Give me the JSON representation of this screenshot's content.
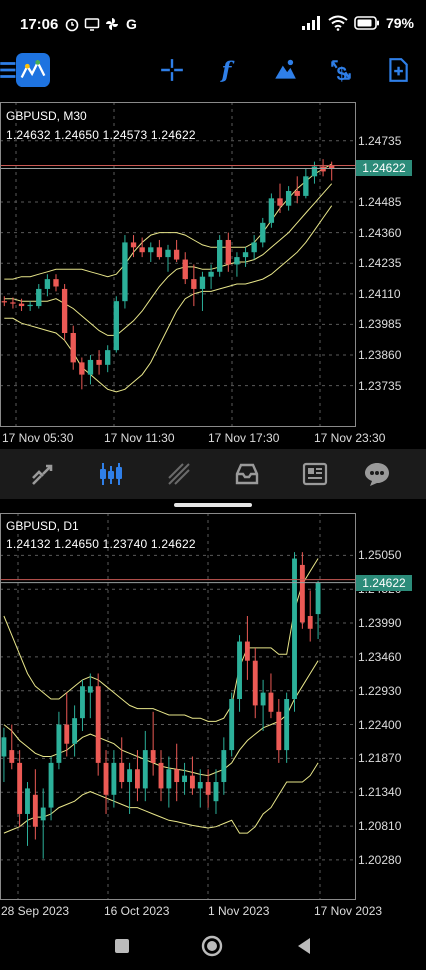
{
  "status_bar": {
    "time": "17:06",
    "battery": "79"
  },
  "colors": {
    "accent": "#2f7fe8",
    "bull": "#2cb09a",
    "bear": "#ec5a55",
    "bands": "#e8e68a",
    "grid": "#5a5a5a",
    "price_tag": "#2c8c7a"
  },
  "toolbar": {
    "icons": [
      "menu-icon",
      "metatrader-logo",
      "crosshair-icon",
      "indicators-icon",
      "objects-icon",
      "symbol-change-icon",
      "new-order-icon"
    ]
  },
  "chart_data": [
    {
      "type": "candlestick",
      "symbol_label": "GBPUSD, M30",
      "ohlc_label": "1.24632 1.24650 1.24573 1.24622",
      "last_price": "1.24622",
      "y_ticks": [
        "1.24735",
        "1.24485",
        "1.24360",
        "1.24235",
        "1.24110",
        "1.23985",
        "1.23860",
        "1.23735"
      ],
      "x_ticks": [
        "17 Nov 05:30",
        "17 Nov 11:30",
        "17 Nov 17:30",
        "17 Nov 23:30"
      ],
      "ylim": [
        1.2366,
        1.2482
      ],
      "candles": [
        [
          1.2408,
          1.241,
          1.2406,
          1.24075
        ],
        [
          1.24075,
          1.24095,
          1.2405,
          1.2407
        ],
        [
          1.2407,
          1.2409,
          1.2404,
          1.2406
        ],
        [
          1.2406,
          1.2408,
          1.2404,
          1.24065
        ],
        [
          1.2406,
          1.2415,
          1.2405,
          1.2413
        ],
        [
          1.2413,
          1.2419,
          1.241,
          1.2417
        ],
        [
          1.2417,
          1.2419,
          1.2412,
          1.2414
        ],
        [
          1.2413,
          1.2415,
          1.2392,
          1.2395
        ],
        [
          1.2395,
          1.2398,
          1.238,
          1.2383
        ],
        [
          1.2383,
          1.2385,
          1.2372,
          1.2378
        ],
        [
          1.2378,
          1.2386,
          1.2374,
          1.2384
        ],
        [
          1.2384,
          1.2388,
          1.2378,
          1.2382
        ],
        [
          1.2382,
          1.239,
          1.2379,
          1.2388
        ],
        [
          1.2388,
          1.241,
          1.2387,
          1.2408
        ],
        [
          1.2408,
          1.2435,
          1.2405,
          1.2432
        ],
        [
          1.2432,
          1.2435,
          1.2426,
          1.243
        ],
        [
          1.243,
          1.2434,
          1.2426,
          1.2428
        ],
        [
          1.2428,
          1.2432,
          1.2424,
          1.243
        ],
        [
          1.243,
          1.2433,
          1.2425,
          1.2426
        ],
        [
          1.2426,
          1.2431,
          1.242,
          1.2429
        ],
        [
          1.2429,
          1.2433,
          1.2424,
          1.2425
        ],
        [
          1.2425,
          1.2428,
          1.2415,
          1.2417
        ],
        [
          1.2417,
          1.2423,
          1.2406,
          1.2413
        ],
        [
          1.2413,
          1.242,
          1.2404,
          1.2418
        ],
        [
          1.2418,
          1.2423,
          1.2413,
          1.242
        ],
        [
          1.242,
          1.2435,
          1.2418,
          1.2433
        ],
        [
          1.2433,
          1.2436,
          1.242,
          1.2423
        ],
        [
          1.2423,
          1.2428,
          1.2418,
          1.2426
        ],
        [
          1.2426,
          1.243,
          1.2422,
          1.2428
        ],
        [
          1.2428,
          1.2435,
          1.2425,
          1.2432
        ],
        [
          1.2432,
          1.2442,
          1.243,
          1.244
        ],
        [
          1.244,
          1.2452,
          1.2438,
          1.245
        ],
        [
          1.245,
          1.2456,
          1.2444,
          1.2447
        ],
        [
          1.2447,
          1.2455,
          1.2445,
          1.2453
        ],
        [
          1.2453,
          1.2459,
          1.2448,
          1.2451
        ],
        [
          1.2451,
          1.2462,
          1.245,
          1.2459
        ],
        [
          1.2459,
          1.2465,
          1.2456,
          1.2463
        ],
        [
          1.2463,
          1.2466,
          1.2459,
          1.2461
        ],
        [
          1.24632,
          1.2465,
          1.24573,
          1.24622
        ]
      ],
      "bands": {
        "upper": [
          1.2417,
          1.2417,
          1.2418,
          1.2418,
          1.2419,
          1.242,
          1.2421,
          1.2421,
          1.2421,
          1.2421,
          1.242,
          1.2419,
          1.2418,
          1.2419,
          1.2423,
          1.2428,
          1.2432,
          1.2435,
          1.2436,
          1.2436,
          1.2436,
          1.2435,
          1.2433,
          1.2431,
          1.243,
          1.243,
          1.243,
          1.243,
          1.243,
          1.2432,
          1.2436,
          1.2441,
          1.2446,
          1.245,
          1.2454,
          1.2457,
          1.246,
          1.2462,
          1.2464
        ],
        "middle": [
          1.2409,
          1.2409,
          1.2408,
          1.2408,
          1.2408,
          1.2408,
          1.2409,
          1.2407,
          1.2405,
          1.2402,
          1.2399,
          1.2396,
          1.2394,
          1.2394,
          1.2397,
          1.24,
          1.2404,
          1.2409,
          1.2414,
          1.2418,
          1.2421,
          1.2422,
          1.2422,
          1.2421,
          1.2421,
          1.2422,
          1.2423,
          1.2424,
          1.2424,
          1.2425,
          1.2427,
          1.243,
          1.2433,
          1.2436,
          1.244,
          1.2444,
          1.2448,
          1.2452,
          1.2456
        ],
        "lower": [
          1.2401,
          1.2401,
          1.2399,
          1.2398,
          1.2397,
          1.2396,
          1.2395,
          1.2392,
          1.2387,
          1.2381,
          1.2378,
          1.2375,
          1.2372,
          1.2371,
          1.2372,
          1.2375,
          1.2378,
          1.2383,
          1.239,
          1.2397,
          1.2404,
          1.2409,
          1.2411,
          1.2412,
          1.2412,
          1.2413,
          1.2414,
          1.2415,
          1.2415,
          1.2416,
          1.2417,
          1.2419,
          1.2422,
          1.2425,
          1.2428,
          1.2432,
          1.2437,
          1.2442,
          1.2447
        ]
      }
    },
    {
      "type": "candlestick",
      "symbol_label": "GBPUSD, D1",
      "ohlc_label": "1.24132 1.24650 1.23740 1.24622",
      "last_price": "1.24622",
      "y_ticks": [
        "1.25050",
        "1.24520",
        "1.23990",
        "1.23460",
        "1.22930",
        "1.22400",
        "1.21870",
        "1.21340",
        "1.20810",
        "1.20280"
      ],
      "x_ticks": [
        "28 Sep 2023",
        "16 Oct 2023",
        "1 Nov 2023",
        "17 Nov 2023"
      ],
      "ylim": [
        1.1995,
        1.254
      ],
      "candles": [
        [
          1.219,
          1.2235,
          1.215,
          1.222
        ],
        [
          1.22,
          1.224,
          1.217,
          1.218
        ],
        [
          1.218,
          1.22,
          1.208,
          1.21
        ],
        [
          1.21,
          1.215,
          1.205,
          1.214
        ],
        [
          1.213,
          1.217,
          1.206,
          1.208
        ],
        [
          1.209,
          1.214,
          1.203,
          1.211
        ],
        [
          1.211,
          1.219,
          1.209,
          1.218
        ],
        [
          1.218,
          1.226,
          1.217,
          1.224
        ],
        [
          1.224,
          1.229,
          1.219,
          1.221
        ],
        [
          1.221,
          1.227,
          1.219,
          1.225
        ],
        [
          1.225,
          1.231,
          1.223,
          1.23
        ],
        [
          1.229,
          1.232,
          1.225,
          1.23
        ],
        [
          1.23,
          1.232,
          1.216,
          1.218
        ],
        [
          1.218,
          1.22,
          1.21,
          1.213
        ],
        [
          1.213,
          1.22,
          1.211,
          1.218
        ],
        [
          1.218,
          1.222,
          1.214,
          1.215
        ],
        [
          1.215,
          1.218,
          1.21,
          1.217
        ],
        [
          1.217,
          1.22,
          1.212,
          1.214
        ],
        [
          1.214,
          1.223,
          1.212,
          1.22
        ],
        [
          1.22,
          1.226,
          1.216,
          1.218
        ],
        [
          1.218,
          1.22,
          1.212,
          1.214
        ],
        [
          1.214,
          1.219,
          1.211,
          1.217
        ],
        [
          1.217,
          1.221,
          1.212,
          1.215
        ],
        [
          1.215,
          1.218,
          1.213,
          1.216
        ],
        [
          1.216,
          1.219,
          1.213,
          1.214
        ],
        [
          1.214,
          1.217,
          1.211,
          1.215
        ],
        [
          1.215,
          1.217,
          1.211,
          1.213
        ],
        [
          1.212,
          1.217,
          1.21,
          1.215
        ],
        [
          1.215,
          1.222,
          1.213,
          1.22
        ],
        [
          1.22,
          1.229,
          1.219,
          1.228
        ],
        [
          1.228,
          1.238,
          1.226,
          1.237
        ],
        [
          1.237,
          1.241,
          1.231,
          1.234
        ],
        [
          1.234,
          1.236,
          1.225,
          1.227
        ],
        [
          1.227,
          1.231,
          1.223,
          1.229
        ],
        [
          1.229,
          1.232,
          1.225,
          1.226
        ],
        [
          1.226,
          1.228,
          1.218,
          1.22
        ],
        [
          1.22,
          1.229,
          1.218,
          1.228
        ],
        [
          1.228,
          1.251,
          1.226,
          1.25
        ],
        [
          1.249,
          1.251,
          1.239,
          1.24
        ],
        [
          1.241,
          1.245,
          1.237,
          1.239
        ],
        [
          1.2413,
          1.2465,
          1.2374,
          1.2462
        ]
      ],
      "bands": {
        "upper": [
          1.241,
          1.238,
          1.235,
          1.232,
          1.23,
          1.229,
          1.228,
          1.228,
          1.229,
          1.23,
          1.231,
          1.2315,
          1.231,
          1.23,
          1.229,
          1.228,
          1.227,
          1.2265,
          1.2265,
          1.2265,
          1.226,
          1.2255,
          1.2255,
          1.2255,
          1.225,
          1.225,
          1.2245,
          1.2245,
          1.225,
          1.227,
          1.233,
          1.236,
          1.236,
          1.236,
          1.236,
          1.235,
          1.235,
          1.242,
          1.246,
          1.248,
          1.25
        ],
        "middle": [
          1.224,
          1.223,
          1.2215,
          1.2205,
          1.2195,
          1.219,
          1.219,
          1.2195,
          1.22,
          1.221,
          1.222,
          1.2225,
          1.222,
          1.2215,
          1.221,
          1.22,
          1.2195,
          1.219,
          1.2185,
          1.218,
          1.2175,
          1.2172,
          1.217,
          1.2168,
          1.2165,
          1.2162,
          1.216,
          1.2165,
          1.217,
          1.218,
          1.22,
          1.2215,
          1.2225,
          1.2235,
          1.224,
          1.2245,
          1.2255,
          1.228,
          1.23,
          1.232,
          1.234
        ],
        "lower": [
          1.207,
          1.2075,
          1.208,
          1.209,
          1.2095,
          1.2095,
          1.21,
          1.211,
          1.2115,
          1.212,
          1.213,
          1.2135,
          1.213,
          1.2125,
          1.212,
          1.2115,
          1.211,
          1.211,
          1.2105,
          1.21,
          1.2095,
          1.209,
          1.2088,
          1.2085,
          1.2082,
          1.208,
          1.2078,
          1.208,
          1.2085,
          1.209,
          1.207,
          1.207,
          1.208,
          1.21,
          1.211,
          1.213,
          1.215,
          1.215,
          1.215,
          1.216,
          1.218
        ]
      }
    }
  ],
  "tabbar": {
    "items": [
      "quotes-icon",
      "chart-icon",
      "trade-icon",
      "history-icon",
      "news-icon",
      "chat-icon"
    ]
  },
  "navbar": {
    "items": [
      "recent-apps-button",
      "home-button",
      "back-button"
    ]
  }
}
